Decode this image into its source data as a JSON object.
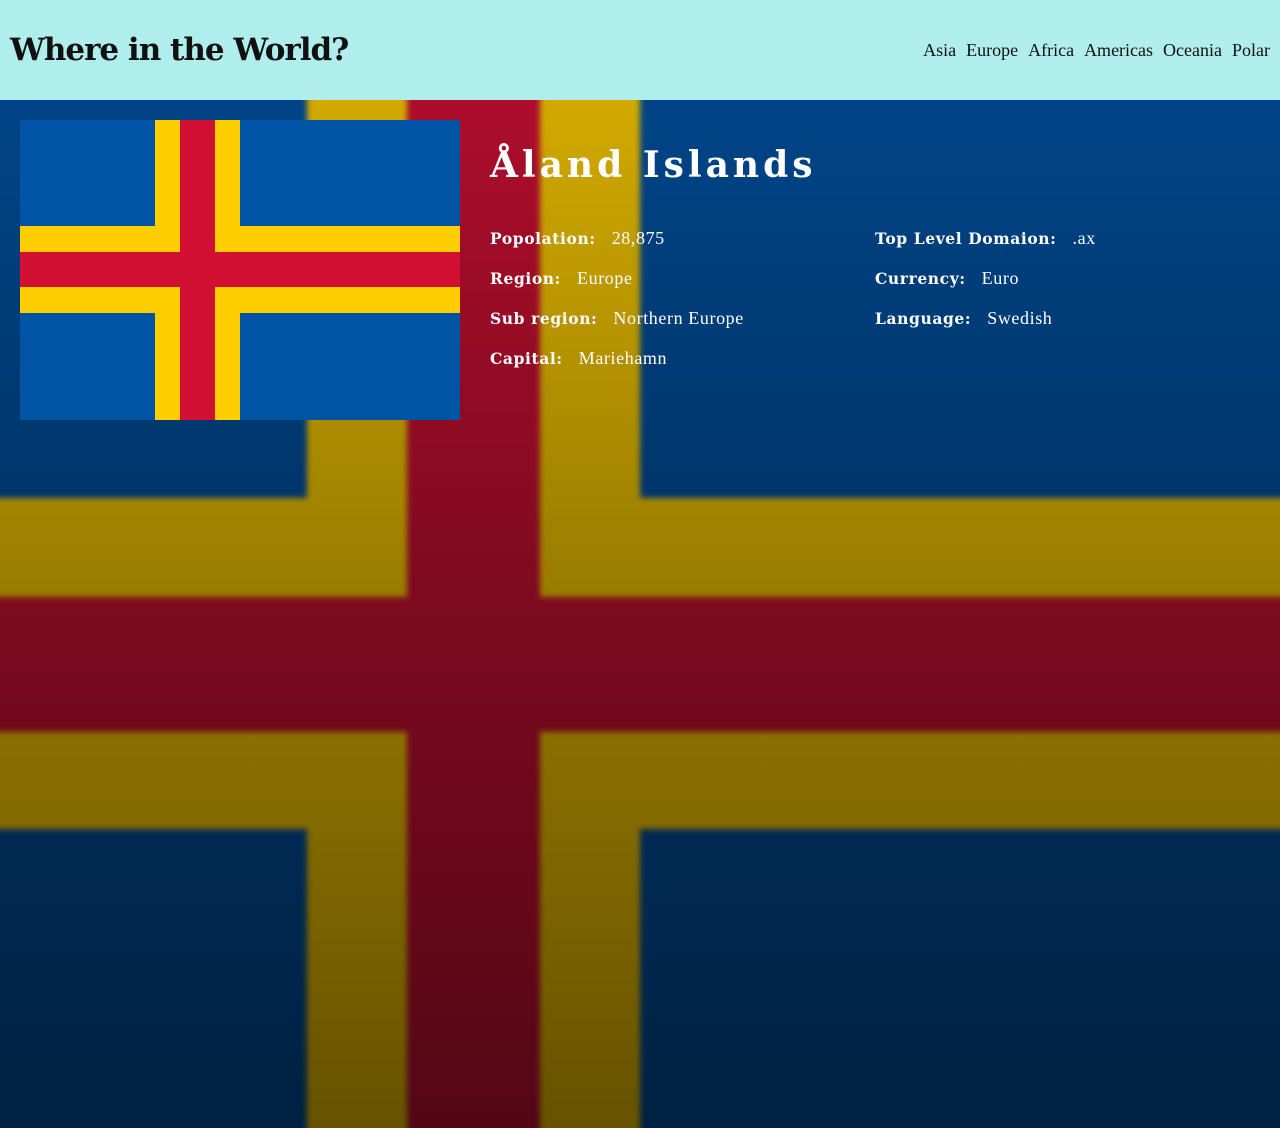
{
  "header": {
    "title": "Where in the World?",
    "nav": [
      "Asia",
      "Europe",
      "Africa",
      "Americas",
      "Oceania",
      "Polar"
    ]
  },
  "flag": {
    "icon": "aland-flag",
    "colors": {
      "blue": "#0053a5",
      "yellow": "#ffce00",
      "red": "#d21034"
    }
  },
  "country": {
    "name": "Åland Islands",
    "left": [
      {
        "label": "Popolation:",
        "value": "28,875"
      },
      {
        "label": "Region:",
        "value": "Europe"
      },
      {
        "label": "Sub region:",
        "value": "Northern Europe"
      },
      {
        "label": "Capital:",
        "value": "Mariehamn"
      }
    ],
    "right": [
      {
        "label": "Top Level Domaion:",
        "value": ".ax"
      },
      {
        "label": "Currency:",
        "value": "Euro"
      },
      {
        "label": "Language:",
        "value": "Swedish"
      }
    ]
  },
  "theme": {
    "header_bg": "#b0eded",
    "text_on_bg": "#ffffff"
  }
}
